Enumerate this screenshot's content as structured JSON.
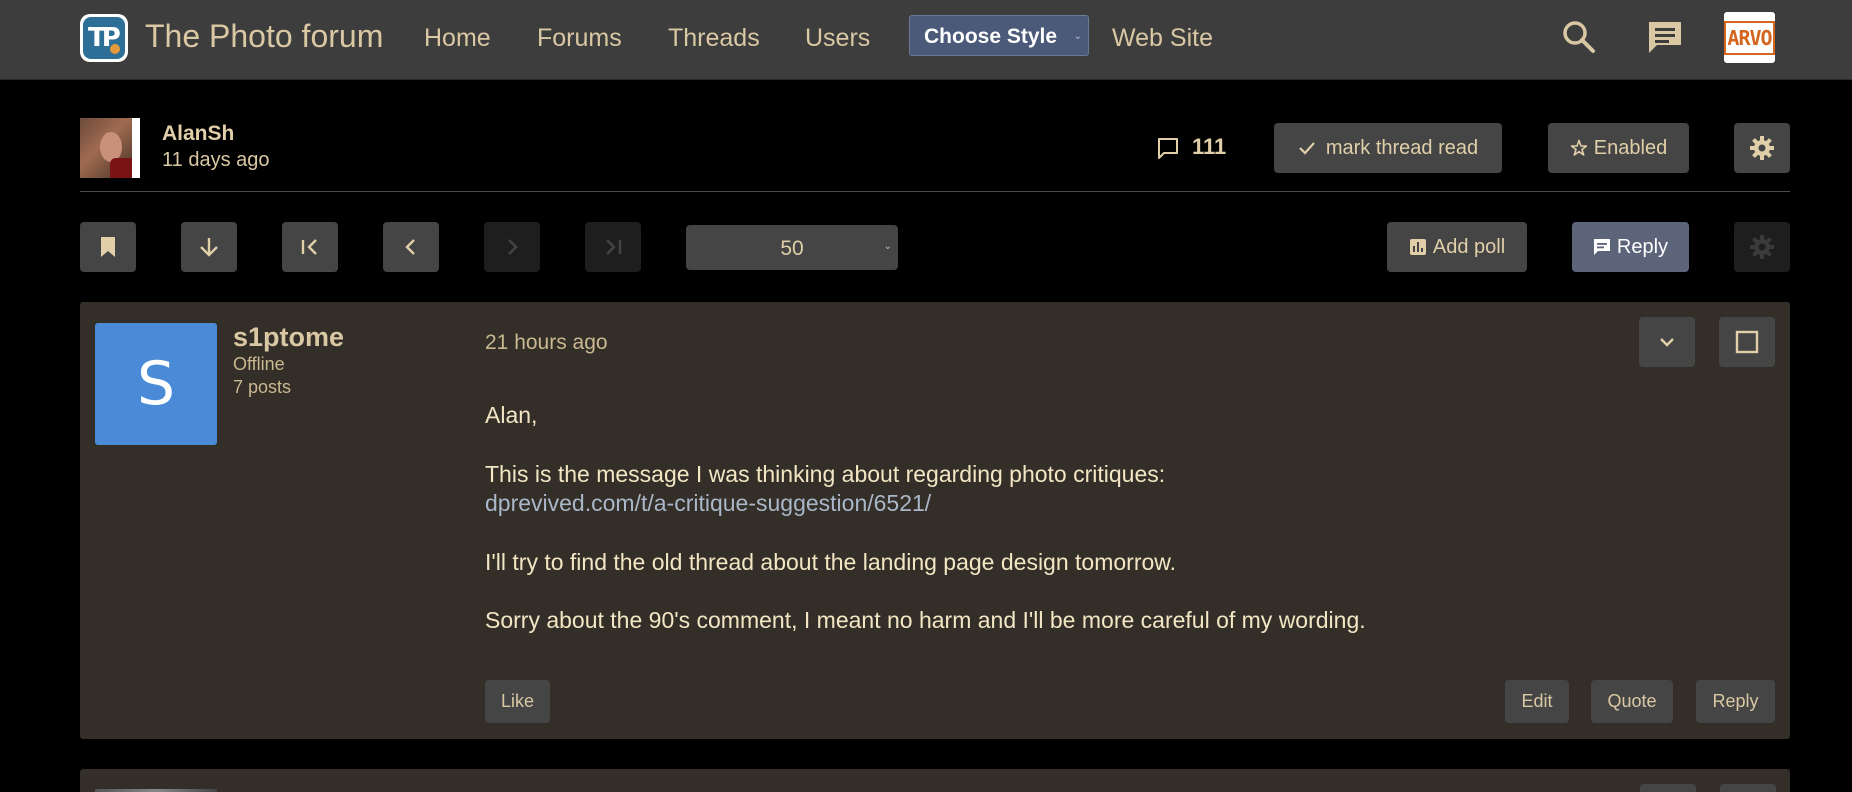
{
  "header": {
    "site_title": "The Photo forum",
    "nav": [
      "Home",
      "Forums",
      "Threads",
      "Users"
    ],
    "style_select": "Choose Style",
    "website_link": "Web Site",
    "user_avatar_text": "ARVO"
  },
  "thread": {
    "author": "AlanSh",
    "time": "11 days ago",
    "reply_count": "111",
    "mark_read_label": "mark thread read",
    "tracking_label": "Enabled"
  },
  "toolbar": {
    "per_page": "50",
    "add_poll_label": "Add poll",
    "reply_label": "Reply"
  },
  "post": {
    "avatar_letter": "S",
    "username": "s1ptome",
    "status": "Offline",
    "post_count": "7 posts",
    "time": "21 hours ago",
    "lines": [
      "Alan,",
      "This is the message I was thinking about regarding photo critiques:",
      "dprevived.com/t/a-critique-suggestion/6521/",
      "I'll try to find the old thread about the landing page design tomorrow.",
      "Sorry about the 90's comment, I meant no harm and I'll be more careful of my wording."
    ],
    "like_label": "Like",
    "edit_label": "Edit",
    "quote_label": "Quote",
    "reply_label": "Reply"
  },
  "colors": {
    "topbar": "#3d3d3d",
    "post_bg": "#332e28",
    "text": "#e8d9b0",
    "link": "#a9b7c8",
    "reply_button": "#5b6478",
    "avatar_blue": "#4a8ad6"
  },
  "icons": [
    "search-icon",
    "chat-icon",
    "comment-icon",
    "check-icon",
    "star-icon",
    "gear-icon",
    "bookmark-icon",
    "arrow-down-icon",
    "first-page-icon",
    "prev-page-icon",
    "next-page-icon",
    "last-page-icon",
    "poll-icon",
    "reply-icon",
    "chevron-down-icon",
    "checkbox-icon"
  ]
}
